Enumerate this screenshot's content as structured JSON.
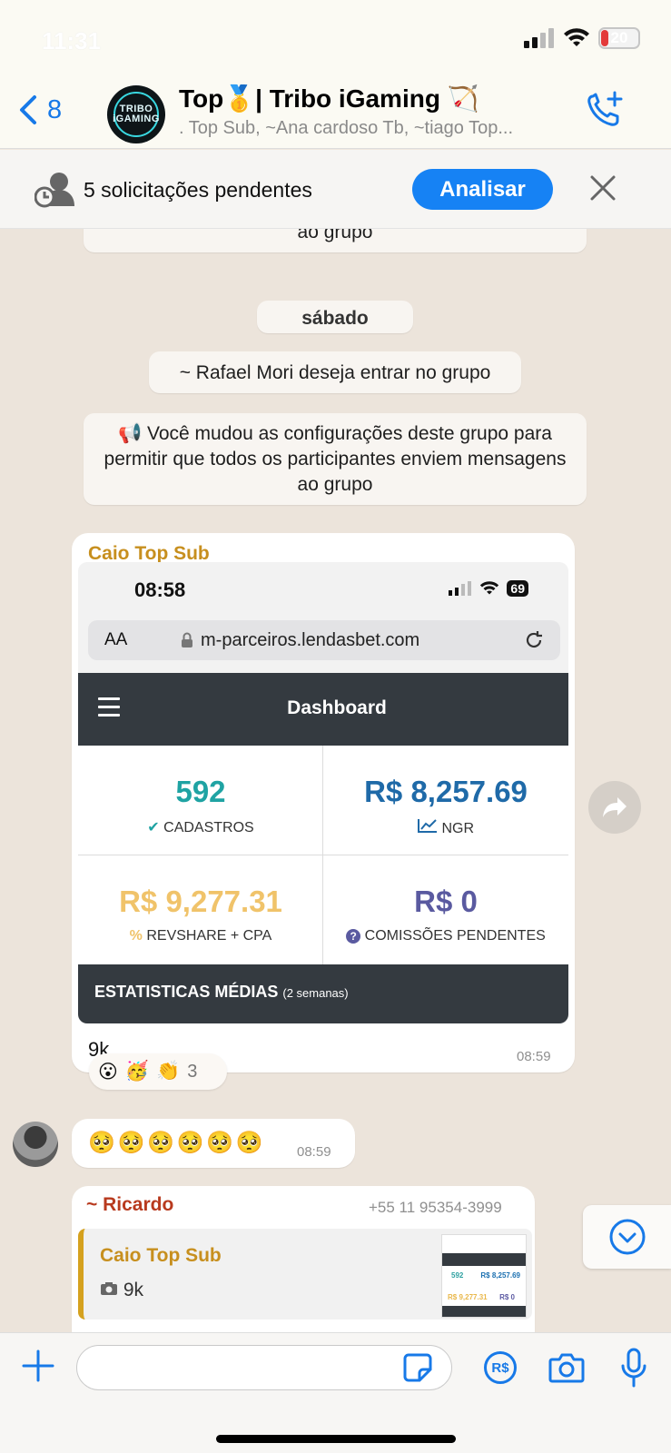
{
  "status": {
    "time": "11:31",
    "battery": "20",
    "battery_level_percent": 20
  },
  "header": {
    "back_count": "8",
    "avatar_text": "TRIBO iGAMING",
    "title": "Top🥇| Tribo iGaming 🏹",
    "subtitle": ". Top Sub, ~Ana cardoso Tb, ~tiago Top..."
  },
  "banner": {
    "text": "5 solicitações pendentes",
    "button": "Analisar"
  },
  "chat": {
    "partial_message": "ao grupo",
    "date_chip": "sábado",
    "join_request": "~ Rafael Mori deseja entrar no grupo",
    "settings_notice": "📢 Você mudou as configurações deste grupo para permitir que todos os participantes enviem mensagens ao grupo",
    "msg1": {
      "sender": "Caio Top Sub",
      "sender_color": "#c78f1e",
      "caption": "9k",
      "time": "08:59",
      "screenshot": {
        "time": "08:58",
        "battery": "69",
        "aa": "AA",
        "url": "m-parceiros.lendasbet.com",
        "dashboard_title": "Dashboard",
        "cards": [
          {
            "value": "592",
            "label": "CADASTROS",
            "icon": "✔",
            "color": "#1fa3a3"
          },
          {
            "value": "R$ 8,257.69",
            "label": "NGR",
            "icon": "📈",
            "color": "#1f6aa8"
          },
          {
            "value": "R$ 9,277.31",
            "label": "REVSHARE + CPA",
            "icon": "%",
            "color": "#f0c36a"
          },
          {
            "value": "R$ 0",
            "label": "COMISSÕES PENDENTES",
            "icon": "?",
            "color": "#5a5aa0"
          }
        ],
        "stats_title": "ESTATISTICAS MÉDIAS",
        "stats_sub": "(2 semanas)"
      },
      "reactions": [
        "😮",
        "🥳",
        "👏"
      ],
      "reaction_count": "3"
    },
    "msg2": {
      "emojis": "🥺 🥺 🥺 🥺 🥺 🥺",
      "time": "08:59"
    },
    "msg3": {
      "sender": "~ Ricardo",
      "phone": "+55 11 95354-3999",
      "quoted_sender": "Caio Top Sub",
      "quoted_caption": "9k",
      "thumb_values": [
        "592",
        "R$ 8,257.69",
        "R$ 9,277.31",
        "R$ 0"
      ]
    }
  },
  "input": {
    "placeholder": "",
    "rs_label": "R$"
  },
  "colors": {
    "accent": "#1779e8",
    "button_blue": "#1682f4",
    "ricardo": "#b83a1e"
  }
}
